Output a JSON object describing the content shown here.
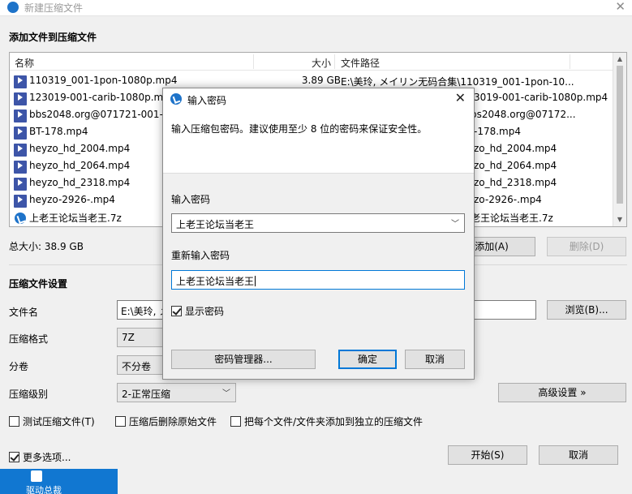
{
  "window": {
    "title": "新建压缩文件",
    "section_add": "添加文件到压缩文件"
  },
  "filelist": {
    "columns": {
      "name": "名称",
      "size": "大小",
      "path": "文件路径"
    },
    "rows": [
      {
        "name": "110319_001-1pon-1080p.mp4",
        "size": "3.89 GB",
        "path": "E:\\美玲, メイリン无码合集\\110319_001-1pon-10...",
        "icon": "mp4-file-icon"
      },
      {
        "name": "123019-001-carib-1080p.mp4",
        "size": "",
        "path": "3019-001-carib-1080p.mp4",
        "icon": "mp4-file-icon"
      },
      {
        "name": "bbs2048.org@071721-001-c",
        "size": "",
        "path": "bs2048.org@07172...",
        "icon": "mp4-file-icon"
      },
      {
        "name": "BT-178.mp4",
        "size": "",
        "path": "-178.mp4",
        "icon": "mp4-file-icon"
      },
      {
        "name": "heyzo_hd_2004.mp4",
        "size": "",
        "path": "zo_hd_2004.mp4",
        "icon": "mp4-file-icon"
      },
      {
        "name": "heyzo_hd_2064.mp4",
        "size": "",
        "path": "zo_hd_2064.mp4",
        "icon": "mp4-file-icon"
      },
      {
        "name": "heyzo_hd_2318.mp4",
        "size": "",
        "path": "zo_hd_2318.mp4",
        "icon": "mp4-file-icon"
      },
      {
        "name": "heyzo-2926-.mp4",
        "size": "",
        "path": "zo-2926-.mp4",
        "icon": "mp4-file-icon"
      },
      {
        "name": "上老王论坛当老王.7z",
        "size": "",
        "path": "老王论坛当老王.7z",
        "icon": "7z-file-icon"
      }
    ]
  },
  "total": "总大小: 38.9 GB",
  "buttons": {
    "add": "添加(A)",
    "delete": "删除(D)",
    "browse": "浏览(B)...",
    "advanced": "高级设置 »",
    "start": "开始(S)",
    "cancel": "取消"
  },
  "settings": {
    "section": "压缩文件设置",
    "filename_label": "文件名",
    "filename_value": "E:\\美玲, メ",
    "format_label": "压缩格式",
    "format_value": "7Z",
    "split_label": "分卷",
    "split_value": "不分卷",
    "level_label": "压缩级别",
    "level_value": "2-正常压缩",
    "test_label": "测试压缩文件(T)",
    "delete_after_label": "压缩后删除原始文件",
    "each_file_label": "把每个文件/文件夹添加到独立的压缩文件",
    "more_options_label": "更多选项..."
  },
  "taskbar": {
    "label": "驱动总裁"
  },
  "dialog": {
    "title": "输入密码",
    "description": "输入压缩包密码。建议使用至少 8 位的密码来保证安全性。",
    "password_label": "输入密码",
    "password_value": "上老王论坛当老王",
    "reenter_label": "重新输入密码",
    "reenter_value": "上老王论坛当老王",
    "show_password_label": "显示密码",
    "manager_button": "密码管理器...",
    "ok_button": "确定",
    "cancel_button": "取消"
  },
  "colors": {
    "accent": "#0078d7",
    "taskbar": "#1177d1",
    "file_icon": "#3d55a8"
  }
}
